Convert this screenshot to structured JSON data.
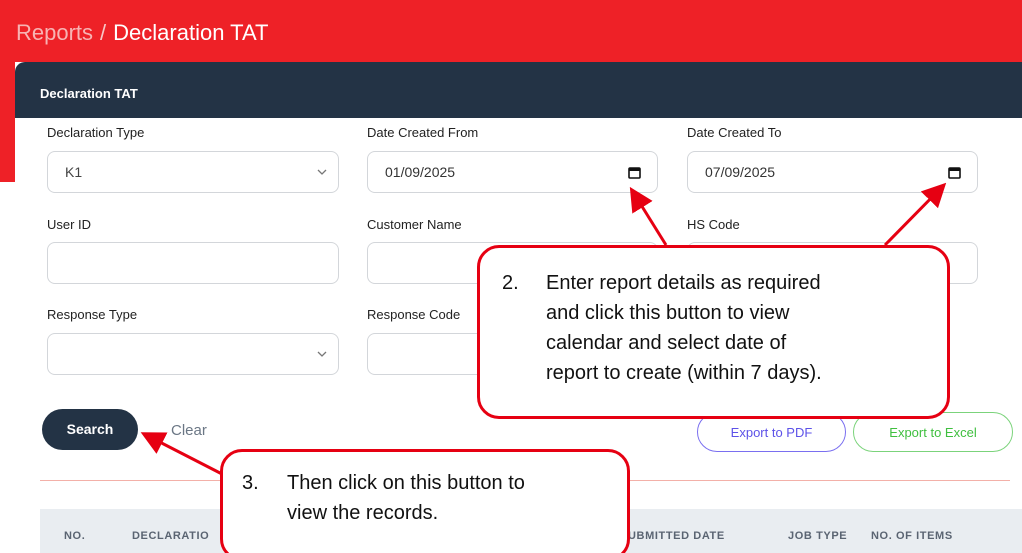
{
  "breadcrumb": {
    "parent": "Reports",
    "separator": "/",
    "current": "Declaration TAT"
  },
  "card": {
    "title": "Declaration TAT"
  },
  "form": {
    "declaration_type": {
      "label": "Declaration Type",
      "value": "K1"
    },
    "date_from": {
      "label": "Date Created From",
      "value": "01/09/2025"
    },
    "date_to": {
      "label": "Date Created To",
      "value": "07/09/2025"
    },
    "user_id": {
      "label": "User ID",
      "value": ""
    },
    "customer_name": {
      "label": "Customer Name",
      "value": ""
    },
    "hs_code": {
      "label": "HS Code",
      "value": ""
    },
    "response_type": {
      "label": "Response Type",
      "value": ""
    },
    "response_code": {
      "label": "Response Code",
      "value": ""
    }
  },
  "actions": {
    "search": "Search",
    "clear": "Clear",
    "export_pdf": "Export to PDF",
    "export_excel": "Export to Excel"
  },
  "table": {
    "headers": [
      "NO.",
      "DECLARATIO",
      "UBMITTED DATE",
      "JOB TYPE",
      "NO. OF ITEMS"
    ]
  },
  "callouts": {
    "step2": {
      "number": "2.",
      "lines": [
        "Enter report details as required",
        "and click this button to view",
        "calendar and select date of",
        "report to create (within 7 days)."
      ]
    },
    "step3": {
      "number": "3.",
      "lines": [
        "Then click on this button to",
        "view the records."
      ]
    }
  },
  "colors": {
    "header_red": "#ee2127",
    "card_navy": "#233345",
    "annotation_red": "#e60012"
  }
}
